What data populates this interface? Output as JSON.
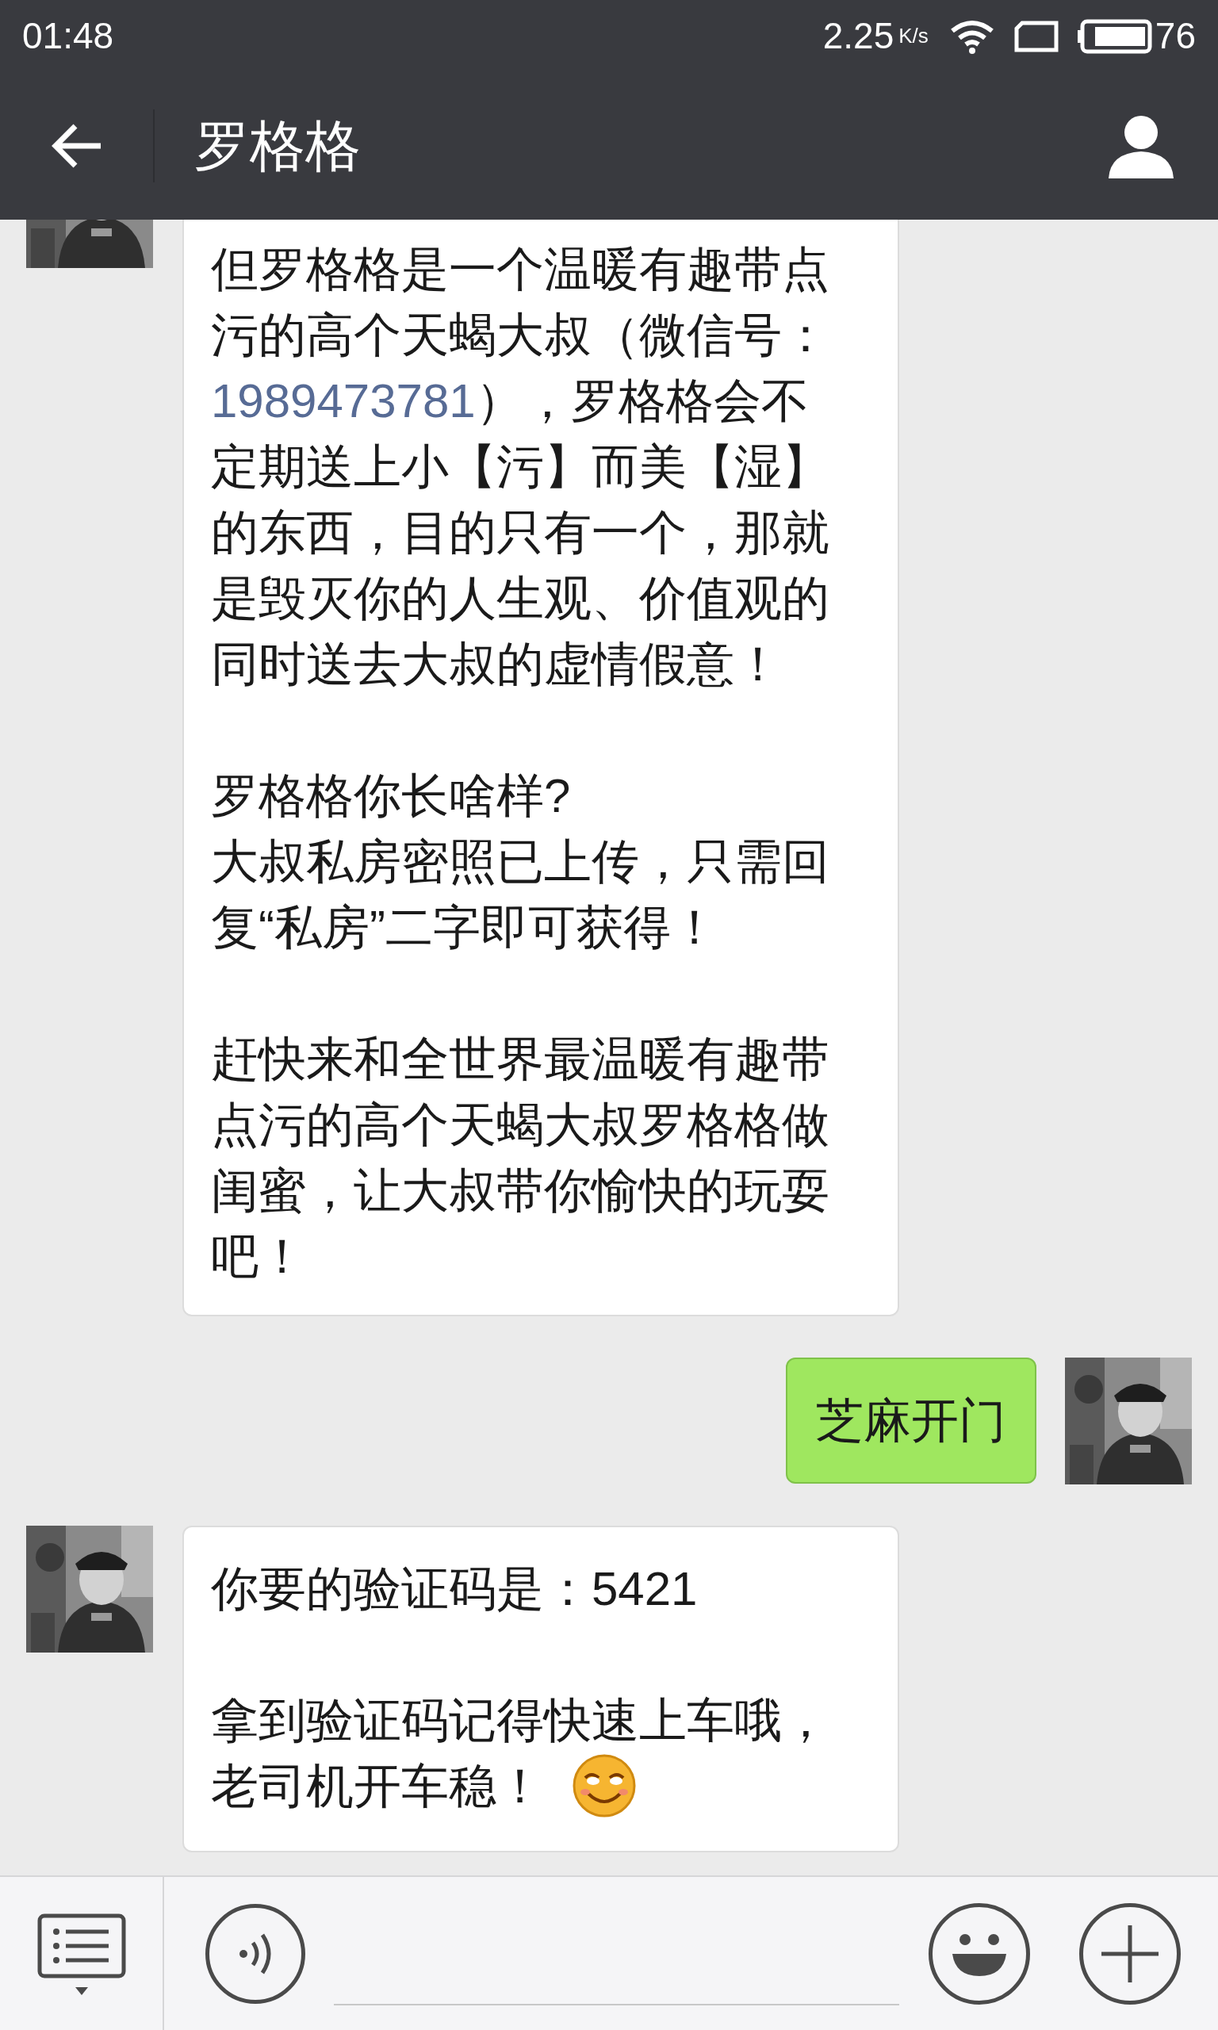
{
  "status_bar": {
    "time": "01:48",
    "speed": "2.25",
    "speed_unit": "K/s",
    "battery": "76"
  },
  "header": {
    "title": "罗格格"
  },
  "messages": [
    {
      "kind": "received",
      "paragraphs": [
        [
          "但罗格格是一个温暖有趣带点",
          "污的高个天蝎大叔（微信号：",
          {
            "link": "1989473781",
            "text": "），罗格格会不"
          },
          "定期送上小【污】而美【湿】",
          "的东西，目的只有一个，那就",
          "是毁灭你的人生观、价值观的",
          "同时送去大叔的虚情假意！"
        ],
        [
          "罗格格你长啥样?",
          "大叔私房密照已上传，只需回",
          "复“私房”二字即可获得！"
        ],
        [
          "赶快来和全世界最温暖有趣带",
          "点污的高个天蝎大叔罗格格做",
          "闺蜜，让大叔带你愉快的玩耍",
          "吧！"
        ]
      ]
    },
    {
      "kind": "sent",
      "paragraphs": [
        [
          "芝麻开门"
        ]
      ]
    },
    {
      "kind": "received",
      "paragraphs": [
        [
          "你要的验证码是：5421"
        ],
        [
          "拿到验证码记得快速上车哦，",
          {
            "text": "老司机开车稳！",
            "emoji": true
          }
        ]
      ]
    }
  ]
}
